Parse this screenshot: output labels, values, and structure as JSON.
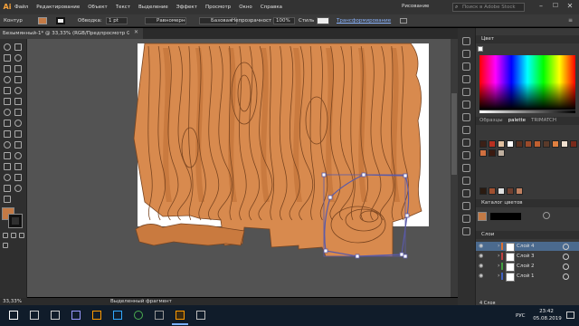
{
  "app": {
    "logo": "Ai",
    "menu": [
      "Файл",
      "Редактирование",
      "Объект",
      "Текст",
      "Выделение",
      "Эффект",
      "Просмотр",
      "Окно",
      "Справка"
    ],
    "workspace": "Рисование",
    "search_placeholder": "Поиск в Adobe Stock"
  },
  "control_bar": {
    "selection_label": "Контур",
    "stroke_label": "Обводка:",
    "stroke_value": "1 pt",
    "profile_value": "Равномерно",
    "brush_value": "Базовая",
    "opacity_label": "Непрозрачность:",
    "opacity_value": "100%",
    "style_label": "Стиль:",
    "transform_label": "Трансформирование",
    "fill_color": "#c47a45"
  },
  "document": {
    "tab_title": "Безымянный-1* @ 33,33% (RGB/Предпросмотр GPU)",
    "zoom": "33,33%",
    "status_text": "Выделенный фрагмент"
  },
  "colors": {
    "wood_light": "#d88a4e",
    "wood_mid": "#c97a3f",
    "wood_line": "#7a4520",
    "artboard": "#ffffff",
    "pasteboard": "#535353",
    "selection": "#5a5aa8"
  },
  "panels": {
    "color_title": "Цвет",
    "swatch_tabs": [
      "Образцы",
      "palette",
      "TRIMATCH"
    ],
    "swatches": [
      "#3a2016",
      "#b83020",
      "#e0c0a0",
      "#ffffff",
      "#5a3020",
      "#9a4a2a",
      "#c06030",
      "#5a3a2a",
      "#e08040",
      "#f0e0d0",
      "#7a2a1a",
      "#d07040",
      "#3a1a10",
      "#c0b0a0"
    ],
    "swatches2": [
      "#2a1a10",
      "#a05030",
      "#e0e0e0",
      "#704030",
      "#c08060"
    ],
    "color_guide_title": "Каталог цветов",
    "layers_title": "Слои",
    "layers": [
      {
        "name": "Слой 4",
        "color": "#e07030",
        "active": true
      },
      {
        "name": "Слой 3",
        "color": "#c04040",
        "active": false
      },
      {
        "name": "Слой 2",
        "color": "#40a040",
        "active": false
      },
      {
        "name": "Слой 1",
        "color": "#4060c0",
        "active": false
      }
    ],
    "layers_count": "4 Слоя"
  },
  "taskbar": {
    "time": "23:42",
    "date": "05.08.2019",
    "lang": "РУС",
    "apps": [
      "start",
      "search",
      "task-view",
      "premiere",
      "illustrator",
      "photoshop",
      "chrome",
      "media",
      "illustrator-active",
      "settings"
    ]
  }
}
